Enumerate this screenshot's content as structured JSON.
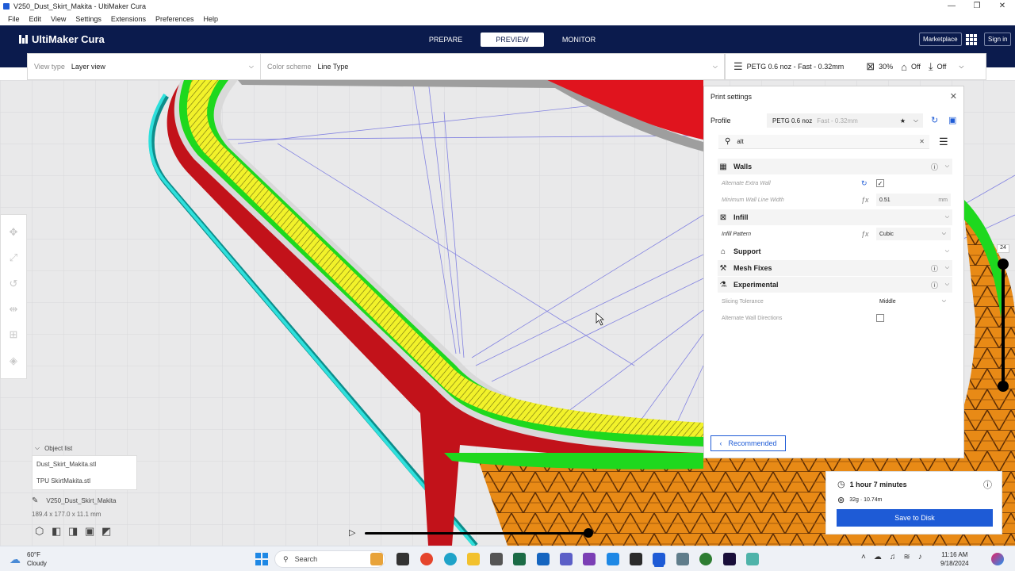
{
  "window": {
    "title": "V250_Dust_Skirt_Makita - UltiMaker Cura",
    "minimize": "—",
    "restore": "❐",
    "close": "✕"
  },
  "menu": [
    "File",
    "Edit",
    "View",
    "Settings",
    "Extensions",
    "Preferences",
    "Help"
  ],
  "header": {
    "logo": "UltiMaker Cura",
    "stages": [
      {
        "label": "PREPARE",
        "active": false
      },
      {
        "label": "PREVIEW",
        "active": true
      },
      {
        "label": "MONITOR",
        "active": false
      }
    ],
    "marketplace": "Marketplace",
    "signin": "Sign in"
  },
  "viewbar": {
    "view_type_label": "View type",
    "view_type_value": "Layer view",
    "color_scheme_label": "Color scheme",
    "color_scheme_value": "Line Type"
  },
  "printbar": {
    "profile": "PETG 0.6 noz - Fast - 0.32mm",
    "infill": "30%",
    "support": "Off",
    "adhesion": "Off"
  },
  "panel": {
    "title": "Print settings",
    "profile_label": "Profile",
    "profile_value": "PETG 0.6 noz",
    "profile_sub": "Fast - 0.32mm",
    "search_value": "alt",
    "categories": {
      "walls": "Walls",
      "infill": "Infill",
      "support": "Support",
      "mesh_fixes": "Mesh Fixes",
      "experimental": "Experimental"
    },
    "settings": {
      "alt_extra_wall": "Alternate Extra Wall",
      "min_wall_line_width": "Minimum Wall Line Width",
      "min_wall_line_width_value": "0.51",
      "min_wall_line_width_unit": "mm",
      "infill_pattern": "Infill Pattern",
      "infill_pattern_value": "Cubic",
      "slicing_tolerance": "Slicing Tolerance",
      "slicing_tolerance_value": "Middle",
      "alt_wall_directions": "Alternate Wall Directions"
    },
    "recommended": "Recommended"
  },
  "objects": {
    "header": "Object list",
    "items": [
      "Dust_Skirt_Makita.stl",
      "TPU SkirtMakita.stl"
    ],
    "current": "V250_Dust_Skirt_Makita",
    "dimensions": "189.4 x 177.0 x 11.1 mm"
  },
  "layer": {
    "current": "24"
  },
  "job": {
    "time": "1 hour 7 minutes",
    "material": "32g · 10.74m",
    "save": "Save to Disk"
  },
  "taskbar": {
    "temp": "60°F",
    "weather": "Cloudy",
    "search": "Search",
    "time": "11:16 AM",
    "date": "9/18/2024"
  },
  "colors": {
    "header": "#0b1b4d",
    "accent": "#1e5bd6",
    "wall_outer": "#e0141e",
    "wall_inner": "#19e619",
    "skin": "#f0f020",
    "infill": "#e88a16",
    "skirt": "#22d3cf"
  }
}
